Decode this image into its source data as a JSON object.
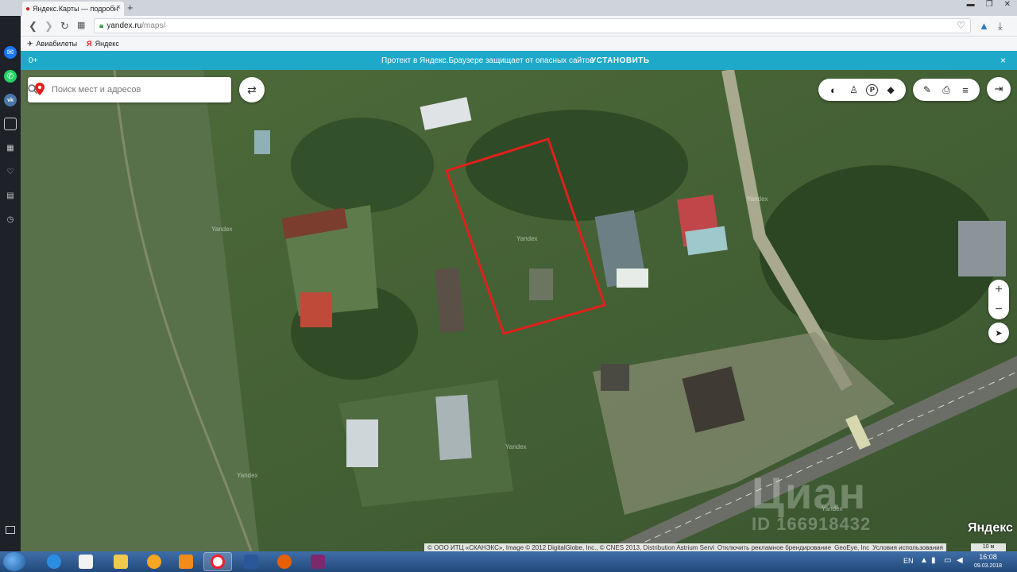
{
  "browser": {
    "tab_title": "Яндекс.Карты — подробн",
    "tab_close": "×",
    "new_tab": "+",
    "url_host": "yandex.ru",
    "url_path": "/maps/",
    "bookmarks": [
      "Авиабилеты",
      "Яндекс"
    ]
  },
  "notify": {
    "age": "0+",
    "message": "Протект в Яндекс.Браузере защищает от опасных сайтов",
    "install": "УСТАНОВИТЬ",
    "close": "×"
  },
  "map": {
    "search_placeholder": "Поиск мест и адресов",
    "watermarks": [
      "Yandex",
      "Yandex",
      "Yandex",
      "Yandex",
      "Yandex",
      "Yandex"
    ],
    "cian_brand": "Циан",
    "cian_id": "ID 166918432",
    "yandex_logo": "Яндекс",
    "copyright": "© ООО ИТЦ «СКАНЭКС», Image © 2012 DigitalGlobe, Inc., © CNES 2013, Distribution Astrium Servi",
    "ad_off": "Отключить рекламное брендирование",
    "geoeye": "GeoEye, Inc",
    "terms": "Условия использования",
    "scale": "10 м",
    "zoom_in": "+",
    "zoom_out": "−",
    "highlight_color": "#e0201b"
  },
  "taskbar": {
    "lang": "EN",
    "time": "16:08",
    "date": "09.03.2018"
  }
}
